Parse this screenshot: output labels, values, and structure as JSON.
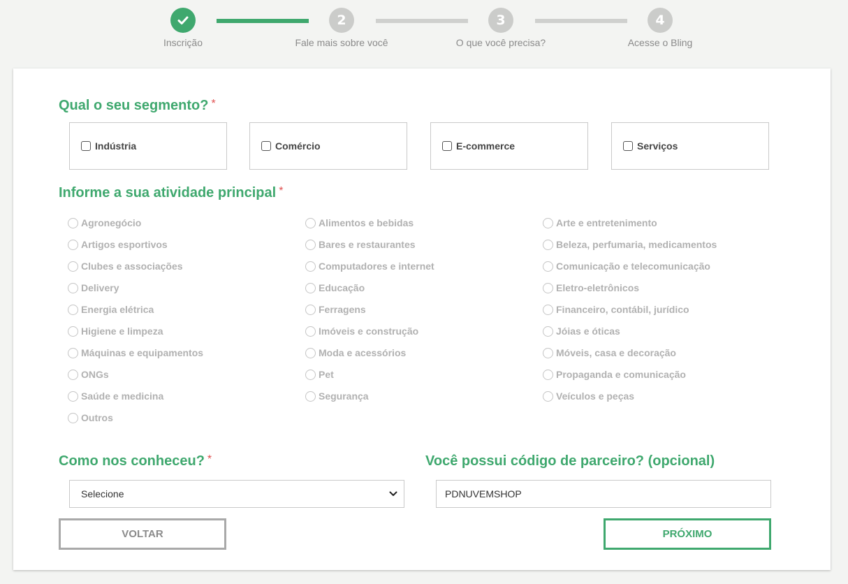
{
  "stepper": {
    "steps": [
      {
        "number": "",
        "label": "Inscrição",
        "state": "done",
        "icon": "check-icon"
      },
      {
        "number": "2",
        "label": "Fale mais sobre você",
        "state": "todo"
      },
      {
        "number": "3",
        "label": "O que você precisa?",
        "state": "todo"
      },
      {
        "number": "4",
        "label": "Acesse o Bling",
        "state": "todo"
      }
    ]
  },
  "segment": {
    "title": "Qual o seu segmento?",
    "required_mark": "*",
    "options": [
      "Indústria",
      "Comércio",
      "E-commerce",
      "Serviços"
    ]
  },
  "activity": {
    "title": "Informe a sua atividade principal",
    "required_mark": "*",
    "columns": [
      [
        "Agronegócio",
        "Artigos esportivos",
        "Clubes e associações",
        "Delivery",
        "Energia elétrica",
        "Higiene e limpeza",
        "Máquinas e equipamentos",
        "ONGs",
        "Saúde e medicina",
        "Outros"
      ],
      [
        "Alimentos e bebidas",
        "Bares e restaurantes",
        "Computadores e internet",
        "Educação",
        "Ferragens",
        "Imóveis e construção",
        "Moda e acessórios",
        "Pet",
        "Segurança"
      ],
      [
        "Arte e entretenimento",
        "Beleza, perfumaria, medicamentos",
        "Comunicação e telecomunicação",
        "Eletro-eletrônicos",
        "Financeiro, contábil, jurídico",
        "Jóias e óticas",
        "Móveis, casa e decoração",
        "Propaganda e comunicação",
        "Veículos e peças"
      ]
    ]
  },
  "source": {
    "title": "Como nos conheceu?",
    "required_mark": "*",
    "selected": "Selecione"
  },
  "partner": {
    "title": "Você possui código de parceiro? (opcional)",
    "value": "PDNUVEMSHOP"
  },
  "buttons": {
    "back": "VOLTAR",
    "next": "PRÓXIMO"
  },
  "colors": {
    "accent": "#3fa86e",
    "required": "#e05050",
    "inactive_step": "#cbccca"
  }
}
